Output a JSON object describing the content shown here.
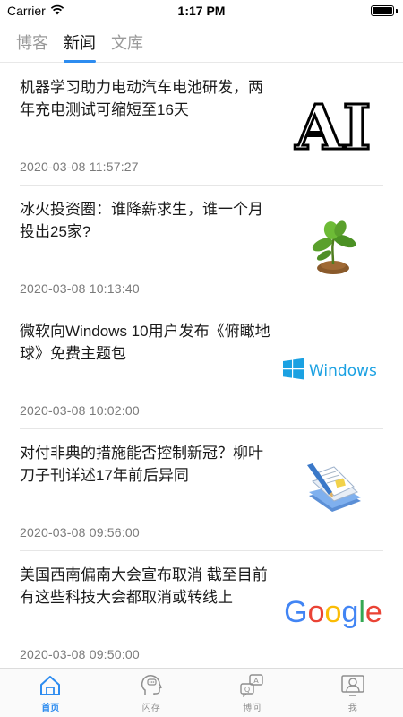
{
  "status_bar": {
    "carrier": "Carrier",
    "time": "1:17 PM"
  },
  "tabs": [
    {
      "label": "博客",
      "active": false
    },
    {
      "label": "新闻",
      "active": true
    },
    {
      "label": "文库",
      "active": false
    }
  ],
  "news": [
    {
      "title": "机器学习助力电动汽车电池研发，两年充电测试可缩短至16天",
      "date": "2020-03-08 11:57:27",
      "thumb_text": "AI",
      "thumb_icon": "ai-logo-icon"
    },
    {
      "title": "冰火投资圈：谁降薪求生，谁一个月投出25家?",
      "date": "2020-03-08 10:13:40",
      "thumb_icon": "plant-sprout-icon"
    },
    {
      "title": "微软向Windows 10用户发布《俯瞰地球》免费主题包",
      "date": "2020-03-08 10:02:00",
      "thumb_text": "Windows",
      "thumb_icon": "windows-logo-icon"
    },
    {
      "title": "对付非典的措施能否控制新冠？柳叶刀子刊详述17年前后异同",
      "date": "2020-03-08 09:56:00",
      "thumb_icon": "documents-pen-icon"
    },
    {
      "title": "美国西南偏南大会宣布取消 截至目前有这些科技大会都取消或转线上",
      "date": "2020-03-08 09:50:00",
      "thumb_text": "Google",
      "thumb_icon": "google-logo-icon"
    }
  ],
  "tabbar": [
    {
      "label": "首页",
      "icon": "home-icon",
      "active": true
    },
    {
      "label": "闪存",
      "icon": "thought-head-icon",
      "active": false
    },
    {
      "label": "博问",
      "icon": "qa-chat-icon",
      "active": false
    },
    {
      "label": "我",
      "icon": "profile-icon",
      "active": false
    }
  ],
  "colors": {
    "accent": "#2d8cf0",
    "google_blue": "#4285F4",
    "google_red": "#EA4335",
    "google_yellow": "#FBBC05",
    "google_green": "#34A853",
    "windows_blue": "#1ba1e2"
  }
}
